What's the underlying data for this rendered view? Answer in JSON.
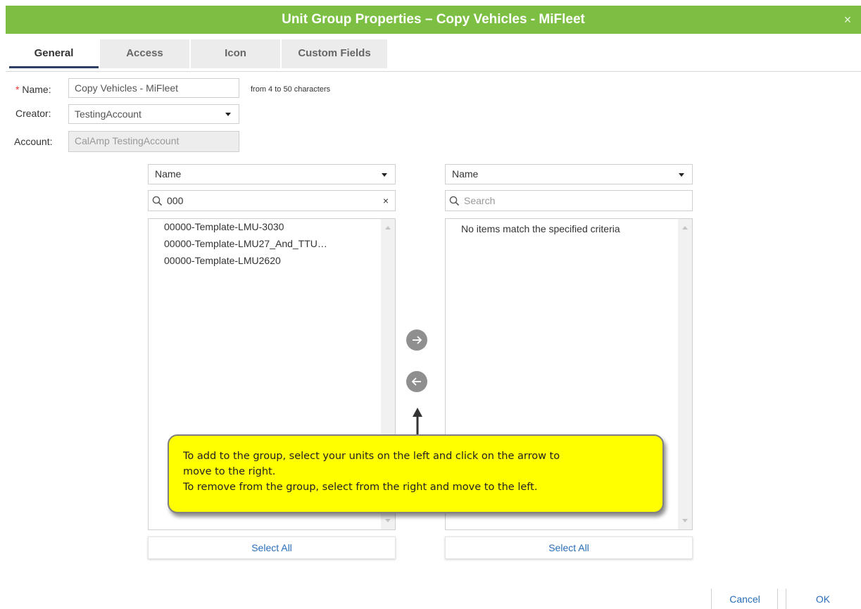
{
  "dialog": {
    "title": "Unit Group Properties – Copy Vehicles - MiFleet",
    "close_symbol": "×",
    "accent_color": "#7cbf42"
  },
  "tabs": [
    {
      "label": "General",
      "active": true
    },
    {
      "label": "Access",
      "active": false
    },
    {
      "label": "Icon",
      "active": false
    },
    {
      "label": "Custom Fields",
      "active": false
    }
  ],
  "form": {
    "name_required_marker": "*",
    "name_label": "Name:",
    "name_value": "Copy Vehicles - MiFleet",
    "name_hint": "from 4 to 50 characters",
    "creator_label": "Creator:",
    "creator_value": "TestingAccount",
    "account_label": "Account:",
    "account_value": "CalAmp TestingAccount"
  },
  "left_panel": {
    "sort_value": "Name",
    "search_value": "000",
    "clear_symbol": "×",
    "items": [
      "00000-Template-LMU-3030",
      "00000-Template-LMU27_And_TTU…",
      "00000-Template-LMU2620"
    ],
    "select_all_label": "Select All"
  },
  "right_panel": {
    "sort_value": "Name",
    "search_placeholder": "Search",
    "empty_message": "No items match the specified criteria",
    "select_all_label": "Select All"
  },
  "transfer": {
    "move_right_icon": "arrow-right-icon",
    "move_left_icon": "arrow-left-icon"
  },
  "callout": {
    "line1": "To add to the group, select your units on the left and click on the arrow to",
    "line2": "move to the right.",
    "line3": "To remove from the group, select from the right and move to the left.",
    "color": "#ffff00"
  },
  "footer": {
    "cancel_label": "Cancel",
    "ok_label": "OK"
  }
}
